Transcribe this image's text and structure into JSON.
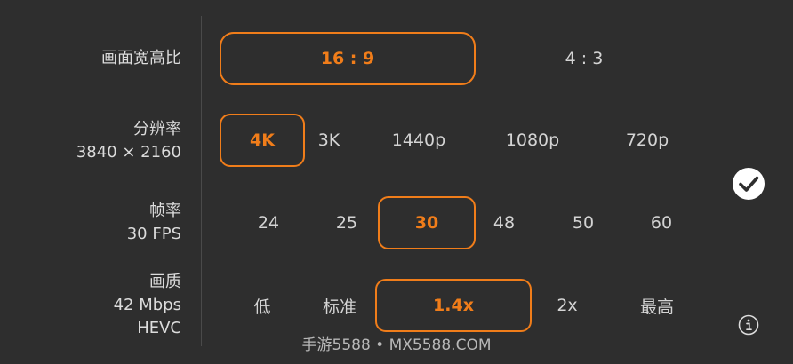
{
  "aspect": {
    "label": "画面宽高比",
    "options": [
      "16 : 9",
      "4 : 3"
    ],
    "selected": "16 : 9"
  },
  "resolution": {
    "label": "分辨率",
    "value": "3840 × 2160",
    "options": [
      "4K",
      "3K",
      "1440p",
      "1080p",
      "720p"
    ],
    "selected": "4K"
  },
  "framerate": {
    "label": "帧率",
    "value": "30 FPS",
    "options": [
      "24",
      "25",
      "30",
      "48",
      "50",
      "60"
    ],
    "selected": "30"
  },
  "quality": {
    "label": "画质",
    "bitrate": "42 Mbps",
    "codec": "HEVC",
    "options": [
      "低",
      "标准",
      "1.4x",
      "2x",
      "最高"
    ],
    "selected": "1.4x"
  },
  "icons": {
    "confirm": "check-circle-icon",
    "info": "info-icon"
  },
  "colors": {
    "accent": "#f07d1a",
    "background": "#2e2e2e"
  },
  "watermark": "手游5588 • MX5588.COM"
}
